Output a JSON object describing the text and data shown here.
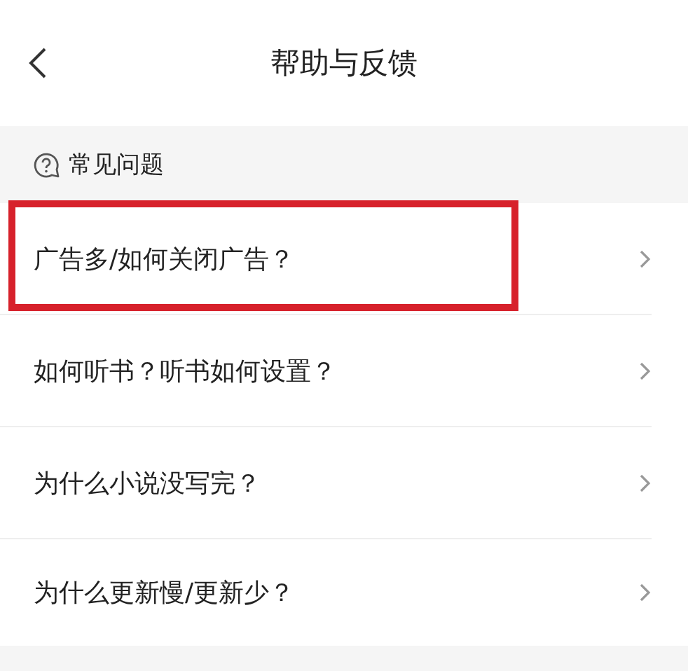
{
  "header": {
    "title": "帮助与反馈"
  },
  "section": {
    "title": "常见问题"
  },
  "questions": [
    {
      "text": "广告多/如何关闭广告？",
      "highlighted": true
    },
    {
      "text": "如何听书？听书如何设置？",
      "highlighted": false
    },
    {
      "text": "为什么小说没写完？",
      "highlighted": false
    },
    {
      "text": "为什么更新慢/更新少？",
      "highlighted": false
    }
  ]
}
